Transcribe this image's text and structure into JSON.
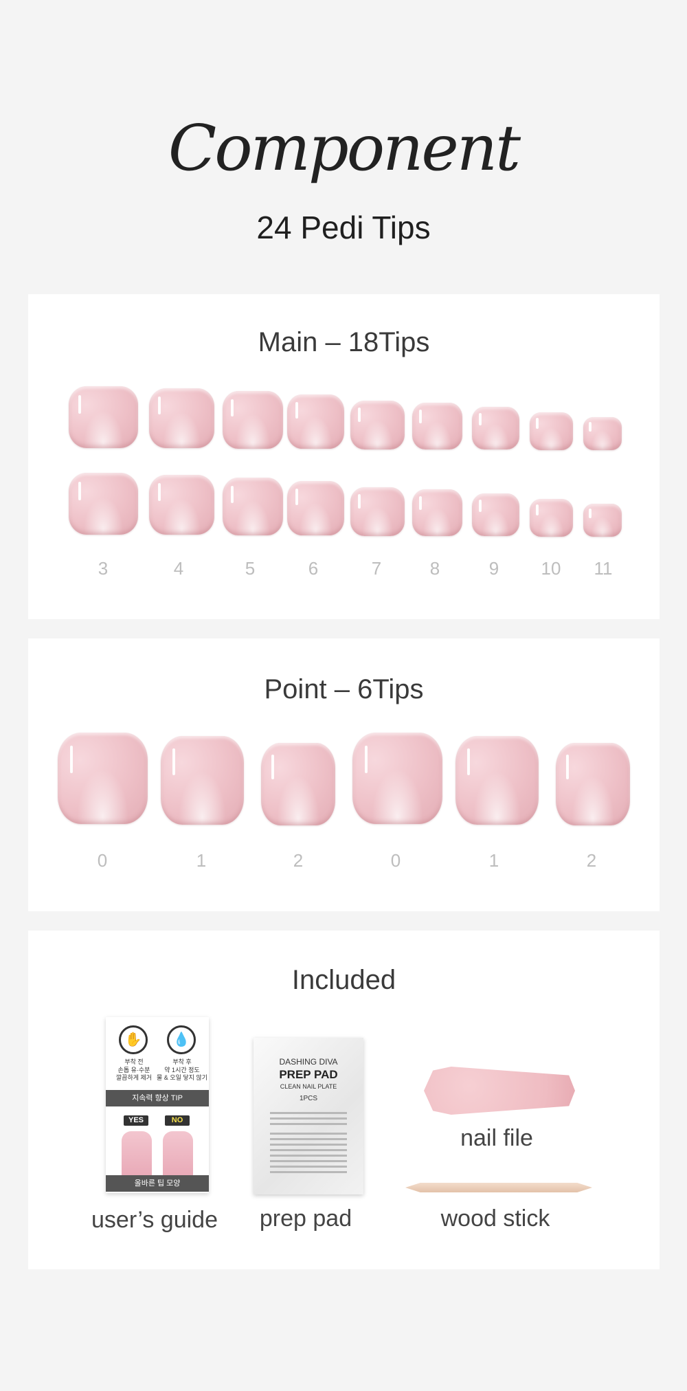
{
  "header": {
    "title": "Component",
    "subtitle": "24 Pedi Tips"
  },
  "main_section": {
    "title": "Main – 18Tips",
    "sizes": [
      "3",
      "4",
      "5",
      "6",
      "7",
      "8",
      "9",
      "10",
      "11"
    ],
    "rows": 2
  },
  "point_section": {
    "title": "Point – 6Tips",
    "sizes": [
      "0",
      "1",
      "2",
      "0",
      "1",
      "2"
    ]
  },
  "included_section": {
    "title": "Included",
    "items": {
      "guide": "user’s guide",
      "prep_pad": "prep pad",
      "nail_file": "nail file",
      "wood_stick": "wood stick"
    },
    "guide_card": {
      "left_text_1": "부착 전",
      "left_text_2": "손톱 유·수분",
      "left_text_3": "깔끔하게 제거",
      "right_text_1": "부착 후",
      "right_text_2": "약 1시간 정도",
      "right_text_3": "물 & 오일 닿지 않기",
      "tip_bar": "지속력 향상 TIP",
      "yes": "YES",
      "no": "NO",
      "bottom_bar": "올바른 팁 모양"
    },
    "pad_pack": {
      "brand": "DASHING DIVA",
      "name": "PREP PAD",
      "sub": "CLEAN NAIL PLATE",
      "qty": "1PCS"
    }
  },
  "colors": {
    "background": "#f4f4f4",
    "panel": "#ffffff",
    "tip_pink": "#eec0c7",
    "label_gray": "#bdbdbd"
  }
}
